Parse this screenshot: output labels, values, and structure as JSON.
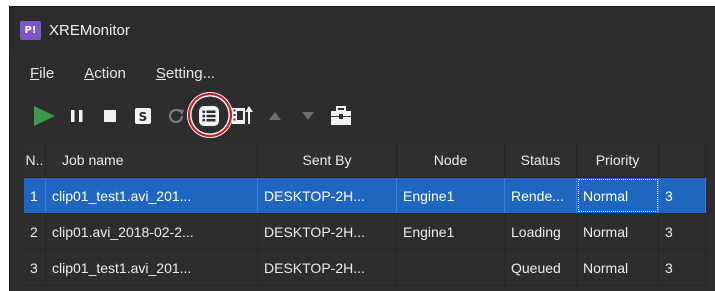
{
  "window": {
    "title": "XREMonitor",
    "app_icon_text": "P!"
  },
  "menu": [
    {
      "label": "File",
      "u": "F",
      "rest": "ile"
    },
    {
      "label": "Action",
      "u": "A",
      "rest": "ction"
    },
    {
      "label": "Setting...",
      "u": "S",
      "rest": "etting..."
    }
  ],
  "toolbar": {
    "items": [
      "start-icon",
      "pause-icon",
      "stop-icon",
      "reset-icon",
      "retry-icon",
      "job-list-icon",
      "media-icon",
      "move-up-icon",
      "move-down-icon",
      "toolbox-icon"
    ],
    "highlighted": "job-list-icon"
  },
  "table": {
    "columns": [
      "N..",
      "Job name",
      "Sent By",
      "Node",
      "Status",
      "Priority",
      ""
    ],
    "rows": [
      {
        "cells": [
          "1",
          "clip01_test1.avi_201...",
          "DESKTOP-2H...",
          "Engine1",
          "Rende...",
          "Normal",
          "3"
        ],
        "selected": true
      },
      {
        "cells": [
          "2",
          "clip01.avi_2018-02-2...",
          "DESKTOP-2H...",
          "Engine1",
          "Loading",
          "Normal",
          "3"
        ],
        "selected": false
      },
      {
        "cells": [
          "3",
          "clip01_test1.avi_201...",
          "DESKTOP-2H...",
          "",
          "Queued",
          "Normal",
          "3"
        ],
        "selected": false
      }
    ]
  },
  "colors": {
    "accent": "#1f66c1",
    "play": "#3a9a48",
    "highlight_ring": "#d01c25",
    "app_icon": "#7d56c8"
  }
}
